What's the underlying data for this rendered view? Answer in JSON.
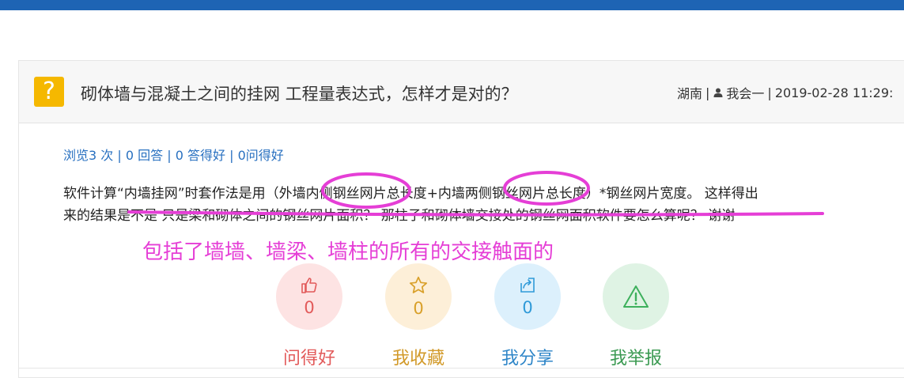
{
  "question": {
    "title": "砌体墙与混凝土之间的挂网 工程量表达式，怎样才是对的？",
    "meta": {
      "region": "湖南",
      "user": "我会一",
      "datetime": "2019-02-28 11:29:"
    },
    "stats": {
      "views": "浏览3 次",
      "answers": "0 回答",
      "good_answers": "0 答得好",
      "helpful": "0问得好"
    },
    "body_line1": "软件计算“内墙挂网”时套作法是用（外墙内侧钢丝网片总长度+内墙两侧钢丝网片总长度）*钢丝网片宽度。 这样得出",
    "body_line2": "来的结果是不是 只是梁和砌体之间的钢丝网片面积？ 那柱子和砌体墙交接处的钢丝网面积软件要怎么算呢？ 谢谢"
  },
  "annotation": {
    "handwritten_note": "包括了墙墙、墙梁、墙柱的所有的交接触面的",
    "color": "#e53ed6"
  },
  "actions": [
    {
      "icon": "thumbs-up-icon",
      "count": "0",
      "label": "问得好",
      "color": "#e25a5a"
    },
    {
      "icon": "star-icon",
      "count": "0",
      "label": "我收藏",
      "color": "#d9a02a"
    },
    {
      "icon": "share-icon",
      "count": "0",
      "label": "我分享",
      "color": "#2f9ad8"
    },
    {
      "icon": "warning-icon",
      "count": "",
      "label": "我举报",
      "color": "#3db05c"
    }
  ],
  "colors": {
    "topbar": "#1e64b4",
    "question_icon": "#f5b800",
    "link": "#2870c0"
  }
}
